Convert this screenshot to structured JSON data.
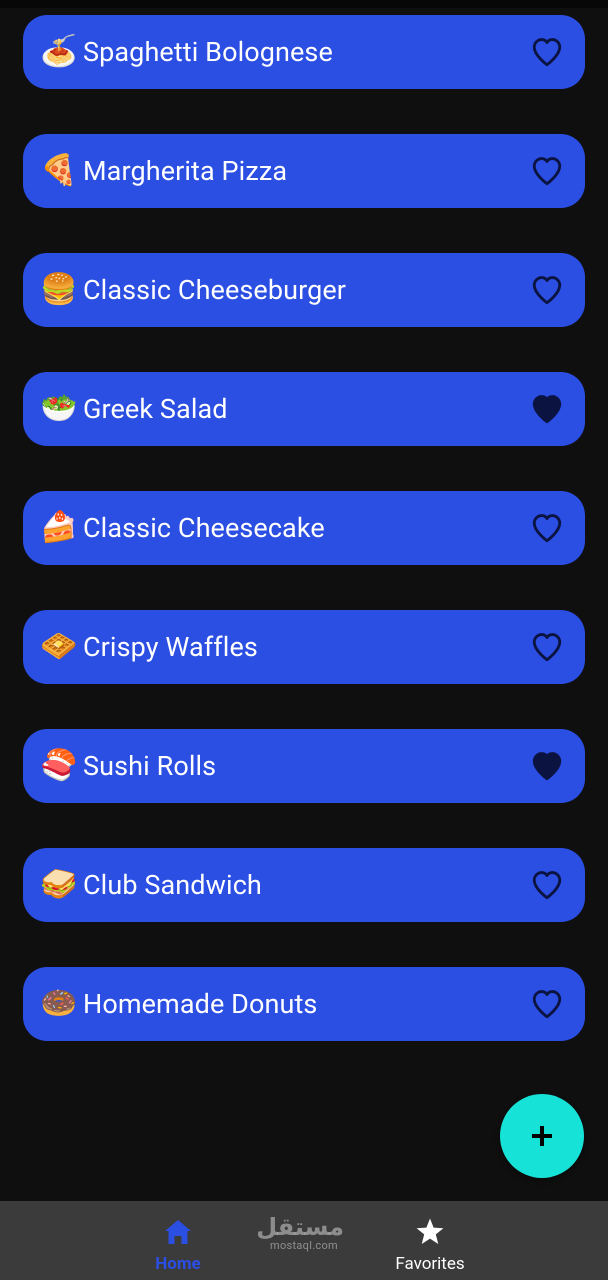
{
  "recipes": [
    {
      "emoji": "🍝",
      "title": "Spaghetti Bolognese",
      "favorite": false
    },
    {
      "emoji": "🍕",
      "title": "Margherita Pizza",
      "favorite": false
    },
    {
      "emoji": "🍔",
      "title": "Classic Cheeseburger",
      "favorite": false
    },
    {
      "emoji": "🥗",
      "title": "Greek Salad",
      "favorite": true
    },
    {
      "emoji": "🍰",
      "title": "Classic Cheesecake",
      "favorite": false
    },
    {
      "emoji": "🧇",
      "title": "Crispy Waffles",
      "favorite": false
    },
    {
      "emoji": "🍣",
      "title": "Sushi Rolls",
      "favorite": true
    },
    {
      "emoji": "🥪",
      "title": "Club Sandwich",
      "favorite": false
    },
    {
      "emoji": "🍩",
      "title": "Homemade Donuts",
      "favorite": false
    }
  ],
  "fab": {
    "icon": "plus-icon"
  },
  "bottom_nav": {
    "home": {
      "label": "Home",
      "icon": "home-icon",
      "active": true
    },
    "favorites": {
      "label": "Favorites",
      "icon": "star-icon",
      "active": false
    }
  },
  "watermark": {
    "logo": "مستقل",
    "domain": "mostaql.com"
  },
  "colors": {
    "background": "#0f0f0f",
    "card": "#2b4ee3",
    "heart": "#0b1340",
    "fab": "#16e2d8",
    "nav_bg": "#3b3b3b",
    "nav_active": "#2b4ee3"
  }
}
